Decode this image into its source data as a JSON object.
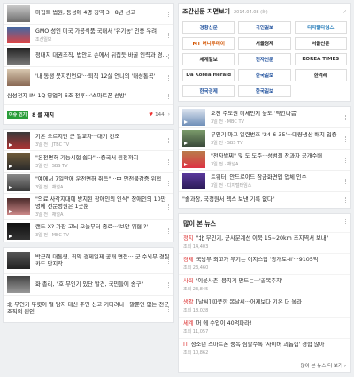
{
  "left": {
    "card1": [
      {
        "title": "미집트 법원, 동성애 4명 징역 3···8년 선고",
        "meta": ""
      },
      {
        "title": "GMO 성인 미국 가공식품 국내서 '유기농' 인증 우려",
        "meta": "조선일보"
      },
      {
        "title": "청대치 대권조직, 법안도 손에서 뒤집듯 바꿀 인력과 경험 검토",
        "meta": ""
      },
      {
        "title": "'내 동생 못지킨언요'···퇴직 12살 언니의 '대성통곡'",
        "meta": ""
      }
    ],
    "card1_last": "삼성전자 IM 1Q 영업익 6조 전후···'스마트폰 선방'",
    "reactions": {
      "badge": "이슈 인기",
      "label": "8 를 재지",
      "count": "144"
    },
    "card2": [
      {
        "title": "기온 오르지만 큰 일교차···대기 건조",
        "meta": "3일 전 · JTBC TV"
      },
      {
        "title": "\"온전면허 기능시험 쉽다\"···중국서 원정까지",
        "meta": "3일 전 · SBS TV"
      },
      {
        "title": "\"예에서 7일만에 운전면허 취득\"···中 안전불감증 위험",
        "meta": "3일 전 · 채널A"
      },
      {
        "title": "\"의료 사각지대에 방치된 장애인의 인식\" 장애인의 10만 명에 전문병원은 1곳뿐",
        "meta": "3일 전 · 채널A"
      },
      {
        "title": "랜드 X? 가장 고뇌 오늘부터 종료···'보안 위협 ?'",
        "meta": "3일 전 · MBC TV"
      }
    ],
    "card3": [
      {
        "title": "박근혜 대통령, 최악 경제일제 공개 면접··· 군 수뇌부 경질 카드 만지작",
        "meta": ""
      },
      {
        "title": "화 총리, \"호 무인기 있단 발견, 국민들에 송구\"",
        "meta": ""
      },
      {
        "title": "北 무인기 뚜렷이 떨 탐지 대신 주민 신고 기다려나···말뿐인 없는 전군 조직의 원인",
        "meta": ""
      }
    ]
  },
  "news": {
    "title": "조간신문 지면보기",
    "date": "2014.04.08 (화)",
    "option": "✓",
    "papers": [
      "경향신문",
      "국민일보",
      "디지털타임스",
      "MT 머니투데이",
      "서울경제",
      "서울신문",
      "세계일보",
      "전자신문",
      "KOREA TIMES",
      "Da Korea Herald",
      "한국일보",
      "한겨레",
      "한국경제",
      "한국일보"
    ]
  },
  "right": {
    "card2": [
      {
        "title": "오전 주도권 미세먼지 높도 '약간나쁨'",
        "meta": "3일 전 · MBC TV"
      },
      {
        "title": "무인기 마그 일련번호 '24-6-35'···대량생산 배치 입증",
        "meta": "3일 전 · SBS TV"
      },
      {
        "title": "\"전자발찌\" 및 도 도주···성범죄 전과자 공개수배",
        "meta": "3일 전 · 채널A"
      },
      {
        "title": "트위터, 안드로이드 잠금화면앱 업체 인수",
        "meta": "3일 전 · 디지털타임스"
      }
    ],
    "card2_last": "\"솔과장, 국정원서 펙스 보낸 기록 없다\"",
    "most": {
      "title": "많이 본 뉴스",
      "items": [
        {
          "cat": "정치",
          "title": "\"北 무인기, 군사분계선 이북 15~20km 조지역서 보내\"",
          "meta": "조회 14,403"
        },
        {
          "cat": "경제",
          "title": "국방부 최고가 무기는 이지스함 '광개토-II'···9105억",
          "meta": "조회 23,460"
        },
        {
          "cat": "사회",
          "title": "'이웃사촌' 뭉치게 만드는···'골목주차'",
          "meta": "조회 23,845"
        },
        {
          "cat": "생활",
          "title": "[날씨] 따뜻한 봄날씨···어제보다 기온 더 올라",
          "meta": "조회 18,028"
        },
        {
          "cat": "세계",
          "title": "머 에 수입이 40억파라!",
          "meta": "조회 11,057"
        },
        {
          "cat": "IT",
          "title": "청소년 스마트폰 중독 심할수록 '사이버 괴롭힘' 경험 많아",
          "meta": "조회 10,862"
        }
      ],
      "more": "많이 본 뉴스 더 보기 ›"
    }
  }
}
